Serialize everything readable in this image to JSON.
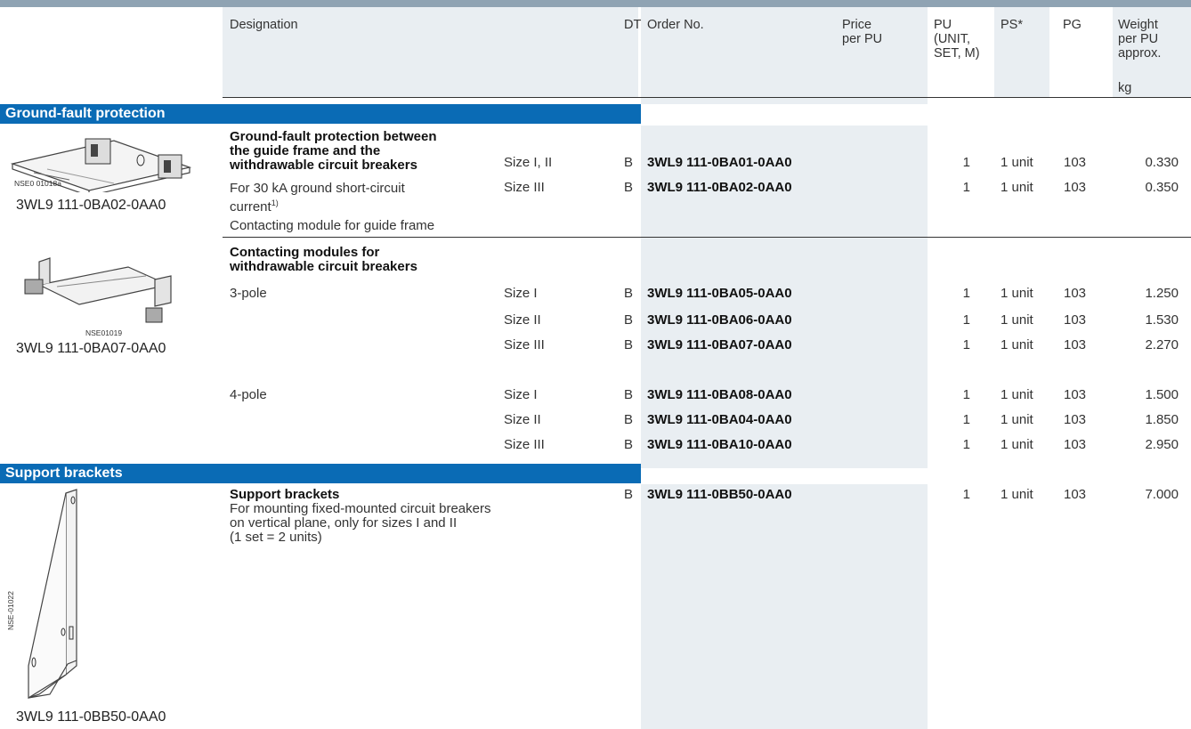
{
  "header": {
    "designation": "Designation",
    "dt": "DT",
    "order_no": "Order No.",
    "price": [
      "Price",
      "per PU"
    ],
    "pu": [
      "PU",
      "(UNIT,",
      "SET, M)"
    ],
    "ps": "PS*",
    "pg": "PG",
    "weight": [
      "Weight",
      "per PU",
      "approx."
    ],
    "weight_unit": "kg"
  },
  "sections": [
    {
      "title": "Ground-fault protection",
      "image_label": "NSE0 01018a",
      "image_caption": "3WL9 111-0BA02-0AA0",
      "desc_bold": [
        "Ground-fault protection between",
        "the guide frame and the",
        "withdrawable circuit breakers"
      ],
      "desc_text1": "For 30 kA ground short-circuit",
      "desc_text2": "current",
      "desc_sup": "1)",
      "desc_text3": "Contacting module for guide frame",
      "rows": [
        {
          "size": "Size I, II",
          "dt": "B",
          "order": "3WL9 111-0BA01-0AA0",
          "pu": "1",
          "ps": "1 unit",
          "pg": "103",
          "weight": "0.330"
        },
        {
          "size": "Size III",
          "dt": "B",
          "order": "3WL9 111-0BA02-0AA0",
          "pu": "1",
          "ps": "1 unit",
          "pg": "103",
          "weight": "0.350"
        }
      ]
    },
    {
      "image_label": "NSE01019",
      "image_caption": "3WL9 111-0BA07-0AA0",
      "desc_bold": [
        "Contacting modules for",
        "withdrawable circuit breakers"
      ],
      "pole3": "3-pole",
      "pole4": "4-pole",
      "rows": [
        {
          "size": "Size I",
          "dt": "B",
          "order": "3WL9 111-0BA05-0AA0",
          "pu": "1",
          "ps": "1 unit",
          "pg": "103",
          "weight": "1.250"
        },
        {
          "size": "Size II",
          "dt": "B",
          "order": "3WL9 111-0BA06-0AA0",
          "pu": "1",
          "ps": "1 unit",
          "pg": "103",
          "weight": "1.530"
        },
        {
          "size": "Size III",
          "dt": "B",
          "order": "3WL9 111-0BA07-0AA0",
          "pu": "1",
          "ps": "1 unit",
          "pg": "103",
          "weight": "2.270"
        },
        {
          "size": "Size I",
          "dt": "B",
          "order": "3WL9 111-0BA08-0AA0",
          "pu": "1",
          "ps": "1 unit",
          "pg": "103",
          "weight": "1.500"
        },
        {
          "size": "Size II",
          "dt": "B",
          "order": "3WL9 111-0BA04-0AA0",
          "pu": "1",
          "ps": "1 unit",
          "pg": "103",
          "weight": "1.850"
        },
        {
          "size": "Size III",
          "dt": "B",
          "order": "3WL9 111-0BA10-0AA0",
          "pu": "1",
          "ps": "1 unit",
          "pg": "103",
          "weight": "2.950"
        }
      ]
    },
    {
      "title": "Support brackets",
      "image_label": "NSE-01022",
      "image_caption": "3WL9 111-0BB50-0AA0",
      "desc_bold": [
        "Support brackets"
      ],
      "desc_lines": [
        "For mounting fixed-mounted circuit breakers",
        "on vertical plane, only for sizes I and II",
        "(1 set = 2 units)"
      ],
      "rows": [
        {
          "dt": "B",
          "order": "3WL9 111-0BB50-0AA0",
          "pu": "1",
          "ps": "1 unit",
          "pg": "103",
          "weight": "7.000"
        }
      ]
    }
  ],
  "colors": {
    "section_bar": "#0a6bb5",
    "column_shade": "#e9eef2",
    "top_rule": "#8fa3b3"
  }
}
